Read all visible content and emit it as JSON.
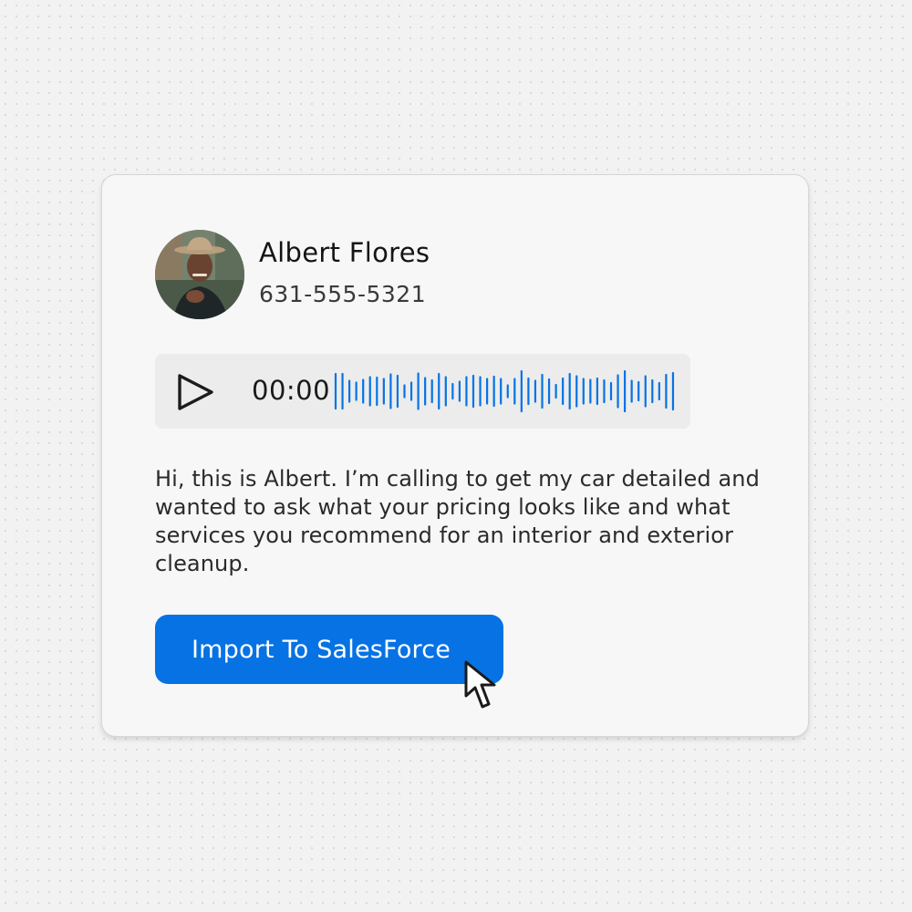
{
  "contact": {
    "name": "Albert Flores",
    "phone": "631-555-5321"
  },
  "player": {
    "time": "00:00",
    "accent": "#0672e4",
    "icon": "play-icon"
  },
  "message": "Hi, this is Albert. I’m calling to get my car detailed and wanted to ask what your pricing looks like and what services you recommend for an interior and exterior cleanup.",
  "actions": {
    "import_label": "Import To SalesForce",
    "color": "#0672e4"
  },
  "icons": {
    "avatar": "person-photo",
    "cursor": "pointer-cursor-icon"
  }
}
